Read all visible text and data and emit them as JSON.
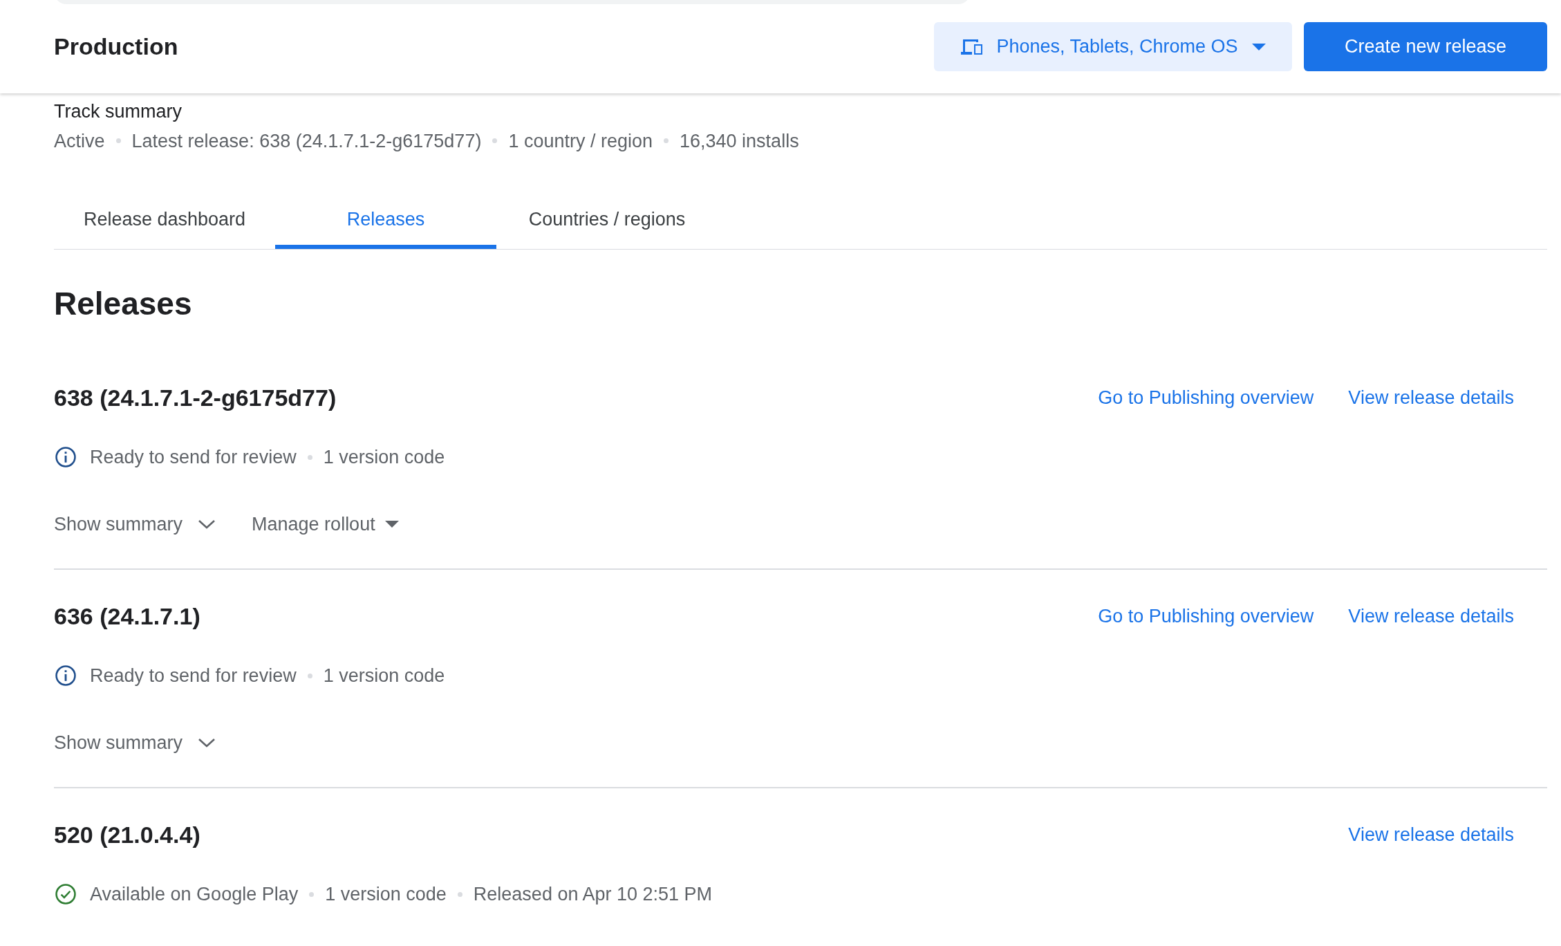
{
  "header": {
    "title": "Production",
    "device_selector": "Phones, Tablets, Chrome OS",
    "primary_button": "Create new release"
  },
  "track_summary": {
    "heading": "Track summary",
    "meta": [
      "Active",
      "Latest release: 638 (24.1.7.1-2-g6175d77)",
      "1 country / region",
      "16,340 installs"
    ]
  },
  "tabs": [
    {
      "label": "Release dashboard",
      "selected": false
    },
    {
      "label": "Releases",
      "selected": true
    },
    {
      "label": "Countries / regions",
      "selected": false
    }
  ],
  "section_title": "Releases",
  "releases": [
    {
      "title": "638 (24.1.7.1-2-g6175d77)",
      "links": [
        "Go to Publishing overview",
        "View release details"
      ],
      "kind": "info",
      "meta": [
        "Ready to send for review",
        "1 version code"
      ],
      "actions": [
        {
          "label": "Show summary",
          "kind": "expand"
        },
        {
          "label": "Manage rollout",
          "kind": "menu"
        }
      ]
    },
    {
      "title": "636 (24.1.7.1)",
      "links": [
        "Go to Publishing overview",
        "View release details"
      ],
      "kind": "info",
      "meta": [
        "Ready to send for review",
        "1 version code"
      ],
      "actions": [
        {
          "label": "Show summary",
          "kind": "expand"
        }
      ]
    },
    {
      "title": "520 (21.0.4.4)",
      "links": [
        "View release details"
      ],
      "kind": "success",
      "meta": [
        "Available on Google Play",
        "1 version code",
        "Released on Apr 10 2:51 PM"
      ]
    }
  ]
}
